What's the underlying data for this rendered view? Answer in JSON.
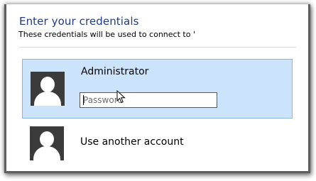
{
  "dialog": {
    "title": "Enter your credentials",
    "subtitle": "These credentials will be used to connect to '"
  },
  "accounts": [
    {
      "name": "Administrator",
      "selected": true,
      "password_placeholder": "Password"
    },
    {
      "name": "Use another account",
      "selected": false
    }
  ],
  "colors": {
    "title": "#1f3b8c",
    "selection_bg": "#cce4fb",
    "selection_border": "#8ab7e0",
    "avatar_bg": "#3b3b3b"
  },
  "icons": {
    "avatar": "user-avatar-icon",
    "cursor": "mouse-pointer-icon"
  }
}
